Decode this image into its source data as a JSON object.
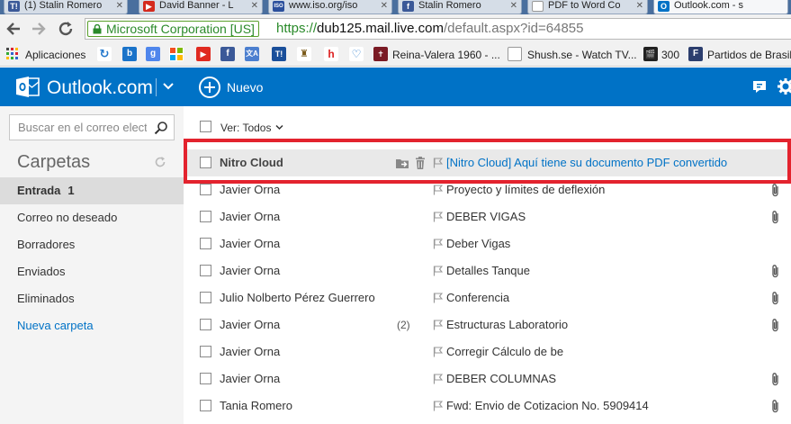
{
  "browser": {
    "tabs": [
      {
        "title": "(1) Stalin Romero",
        "favicon": "T!",
        "color": "#3b5998"
      },
      {
        "title": "David Banner - L",
        "favicon": "▶",
        "color": "#d42a1e"
      },
      {
        "title": "www.iso.org/iso",
        "favicon": "ISO",
        "color": "#2b4f9c"
      },
      {
        "title": "Stalin Romero",
        "favicon": "f",
        "color": "#3b5998"
      },
      {
        "title": "PDF to Word Co",
        "favicon": "",
        "color": "#ffffff"
      },
      {
        "title": "Outlook.com - s",
        "favicon": "O",
        "color": "#0072c6"
      }
    ],
    "nav": {
      "back_icon": "back-arrow-icon",
      "forward_icon": "forward-arrow-icon",
      "reload_icon": "reload-icon"
    },
    "ev_cert": "Microsoft Corporation [US]",
    "url": {
      "scheme": "https://",
      "host": "dub125.mail.live.com",
      "path": "/default.aspx?id=64855"
    },
    "bookmarks": [
      {
        "label": "Aplicaciones",
        "icon": "apps-grid-icon"
      },
      {
        "label": "Reina-Valera 1960 - ...",
        "icon": "bible-icon"
      },
      {
        "label": "Shush.se - Watch TV...",
        "icon": "page-icon"
      },
      {
        "label": "300",
        "icon": "clapper-icon"
      },
      {
        "label": "Partidos de Brasil",
        "icon": "pdf-icon"
      }
    ]
  },
  "outlook": {
    "brand": "Outlook.com",
    "new_label": "Nuevo",
    "accent_color": "#0072c6"
  },
  "sidebar": {
    "search_placeholder": "Buscar en el correo electrónico",
    "folders_title": "Carpetas",
    "folders": [
      {
        "label": "Entrada",
        "count": "1",
        "selected": true
      },
      {
        "label": "Correo no deseado",
        "count": ""
      },
      {
        "label": "Borradores",
        "count": ""
      },
      {
        "label": "Enviados",
        "count": ""
      },
      {
        "label": "Eliminados",
        "count": ""
      },
      {
        "label": "Nueva carpeta",
        "count": "",
        "link": true
      }
    ]
  },
  "list": {
    "filter_label": "Ver: Todos",
    "messages": [
      {
        "sender": "Nitro Cloud",
        "subject": "[Nitro Cloud] Aquí tiene su documento PDF convertido",
        "unread": true,
        "attachment": false,
        "thread_count": ""
      },
      {
        "sender": "Javier Orna",
        "subject": "Proyecto y límites de deflexión",
        "attachment": true,
        "thread_count": ""
      },
      {
        "sender": "Javier Orna",
        "subject": "DEBER VIGAS",
        "attachment": true,
        "thread_count": ""
      },
      {
        "sender": "Javier Orna",
        "subject": "Deber Vigas",
        "attachment": false,
        "thread_count": ""
      },
      {
        "sender": "Javier Orna",
        "subject": "Detalles Tanque",
        "attachment": true,
        "thread_count": ""
      },
      {
        "sender": "Julio Nolberto Pérez Guerrero",
        "subject": "Conferencia",
        "attachment": true,
        "thread_count": ""
      },
      {
        "sender": "Javier Orna",
        "subject": "Estructuras Laboratorio",
        "attachment": true,
        "thread_count": "(2)"
      },
      {
        "sender": "Javier Orna",
        "subject": "Corregir Cálculo de be",
        "attachment": false,
        "thread_count": ""
      },
      {
        "sender": "Javier Orna",
        "subject": "DEBER COLUMNAS",
        "attachment": true,
        "thread_count": ""
      },
      {
        "sender": "Tania Romero",
        "subject": "Fwd: Envio de Cotizacion No. 5909414",
        "attachment": true,
        "thread_count": ""
      }
    ]
  },
  "highlight_color": "#e3232e"
}
